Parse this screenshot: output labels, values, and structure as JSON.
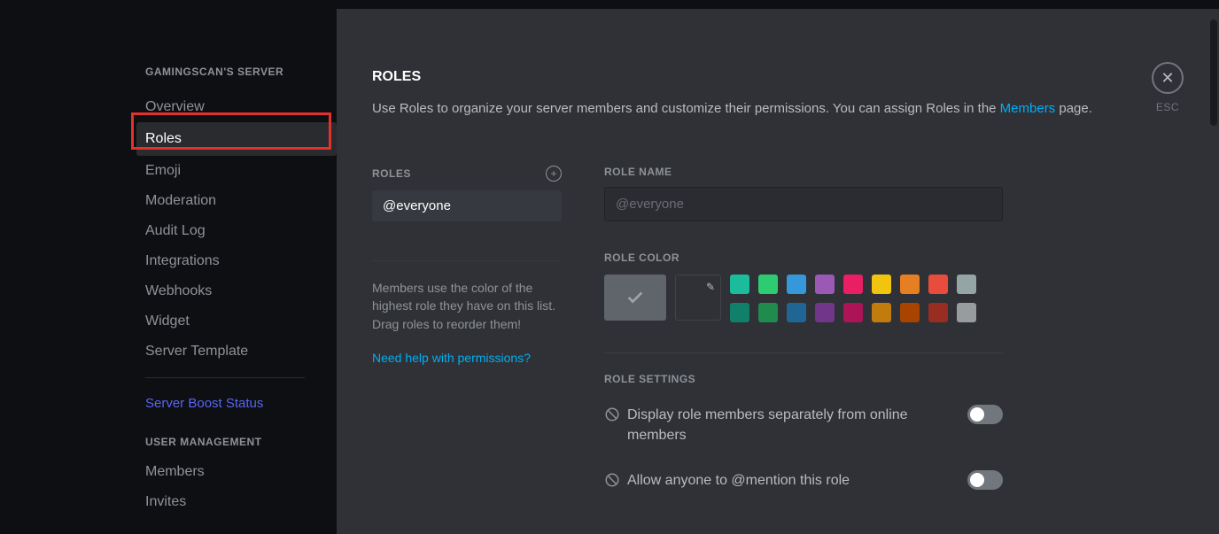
{
  "sidebar": {
    "section1_header": "GAMINGSCAN'S SERVER",
    "items": [
      {
        "label": "Overview"
      },
      {
        "label": "Roles"
      },
      {
        "label": "Emoji"
      },
      {
        "label": "Moderation"
      },
      {
        "label": "Audit Log"
      },
      {
        "label": "Integrations"
      },
      {
        "label": "Webhooks"
      },
      {
        "label": "Widget"
      },
      {
        "label": "Server Template"
      }
    ],
    "boost_label": "Server Boost Status",
    "section2_header": "USER MANAGEMENT",
    "user_items": [
      {
        "label": "Members"
      },
      {
        "label": "Invites"
      }
    ]
  },
  "content": {
    "title": "ROLES",
    "description_pre": "Use Roles to organize your server members and customize their permissions. You can assign Roles in the ",
    "description_link": "Members",
    "description_post": " page.",
    "close_label": "ESC"
  },
  "roles_col": {
    "label": "ROLES",
    "selected": "@everyone",
    "help_text": "Members use the color of the highest role they have on this list. Drag roles to reorder them!",
    "help_link": "Need help with permissions?"
  },
  "name_col": {
    "label": "ROLE NAME",
    "placeholder": "@everyone"
  },
  "color": {
    "label": "ROLE COLOR",
    "swatches": [
      "#1abc9c",
      "#2ecc71",
      "#3498db",
      "#9b59b6",
      "#e91e63",
      "#f1c40f",
      "#e67e22",
      "#e74c3c",
      "#95a5a6",
      "#11806a",
      "#1f8b4c",
      "#206694",
      "#71368a",
      "#ad1457",
      "#c27c0e",
      "#a84300",
      "#992d22",
      "#979c9f"
    ]
  },
  "settings": {
    "header": "ROLE SETTINGS",
    "items": [
      {
        "label": "Display role members separately from online members"
      },
      {
        "label": "Allow anyone to @mention this role"
      }
    ]
  }
}
